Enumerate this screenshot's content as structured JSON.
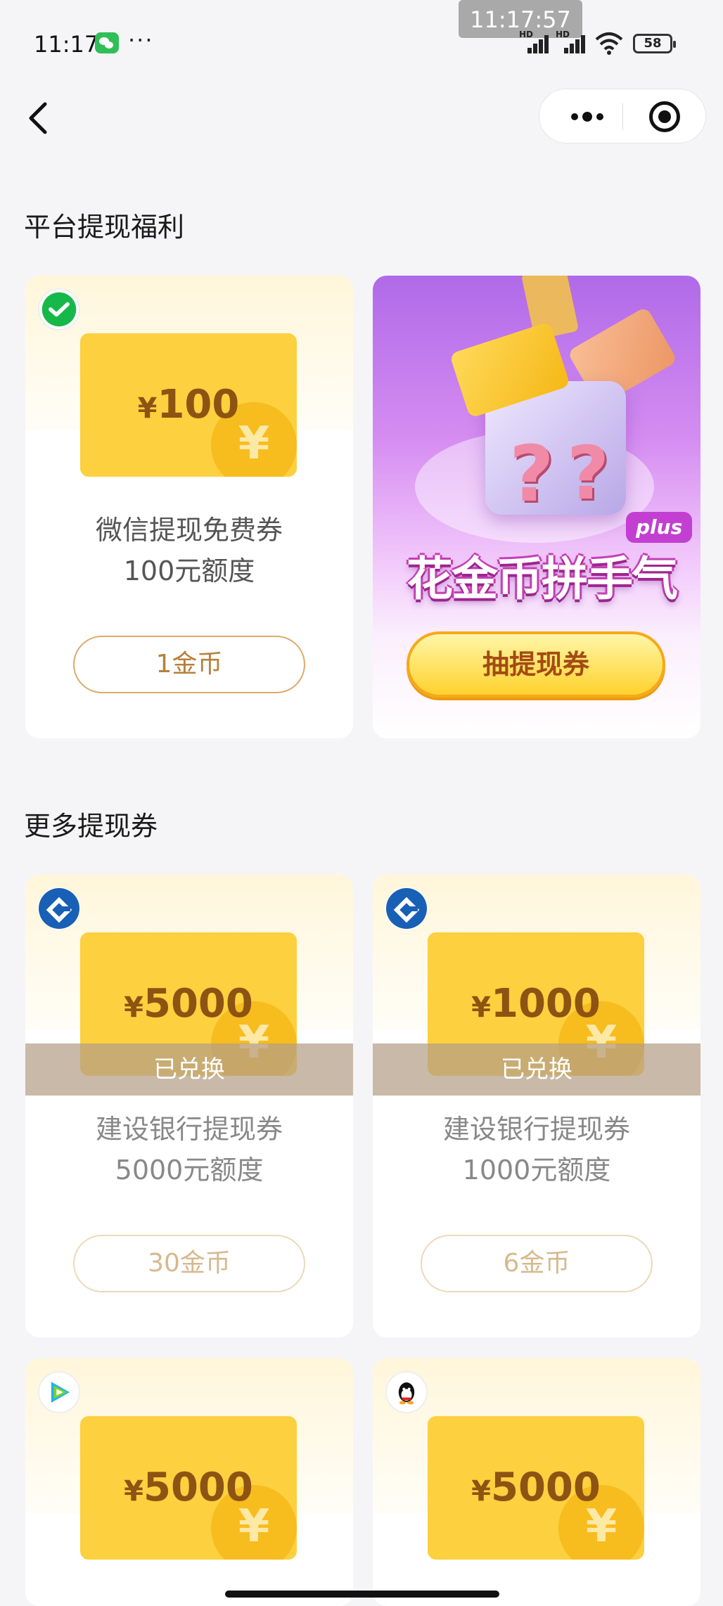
{
  "status_bar": {
    "time": "11:17",
    "dots": "···",
    "clock_overlay": "11:17:57",
    "signal_label": "HD",
    "battery": "58"
  },
  "colors": {
    "accent_gold": "#fcd03e",
    "brand_purple": "#b06ae8",
    "price_border": "#d9ab6c"
  },
  "sections": {
    "platform": "平台提现福利",
    "more": "更多提现券"
  },
  "platform_card": {
    "logo": "wechat-pay-icon",
    "amount": "100",
    "currency": "¥",
    "name_line1": "微信提现免费券",
    "name_line2": "100元额度",
    "price": "1金币"
  },
  "promo_card": {
    "headline": "花金币拼手气",
    "badge": "plus",
    "button": "抽提现券",
    "coin_symbol": "¥"
  },
  "more_cards": [
    {
      "logo": "ccb-bank-icon",
      "currency": "¥",
      "amount": "5000",
      "status": "已兑换",
      "name_line1": "建设银行提现券",
      "name_line2": "5000元额度",
      "price": "30金币"
    },
    {
      "logo": "ccb-bank-icon",
      "currency": "¥",
      "amount": "1000",
      "status": "已兑换",
      "name_line1": "建设银行提现券",
      "name_line2": "1000元额度",
      "price": "6金币"
    },
    {
      "logo": "tencent-video-icon",
      "currency": "¥",
      "amount": "5000"
    },
    {
      "logo": "qq-icon",
      "currency": "¥",
      "amount": "5000"
    }
  ],
  "coin_glyph": "¥"
}
